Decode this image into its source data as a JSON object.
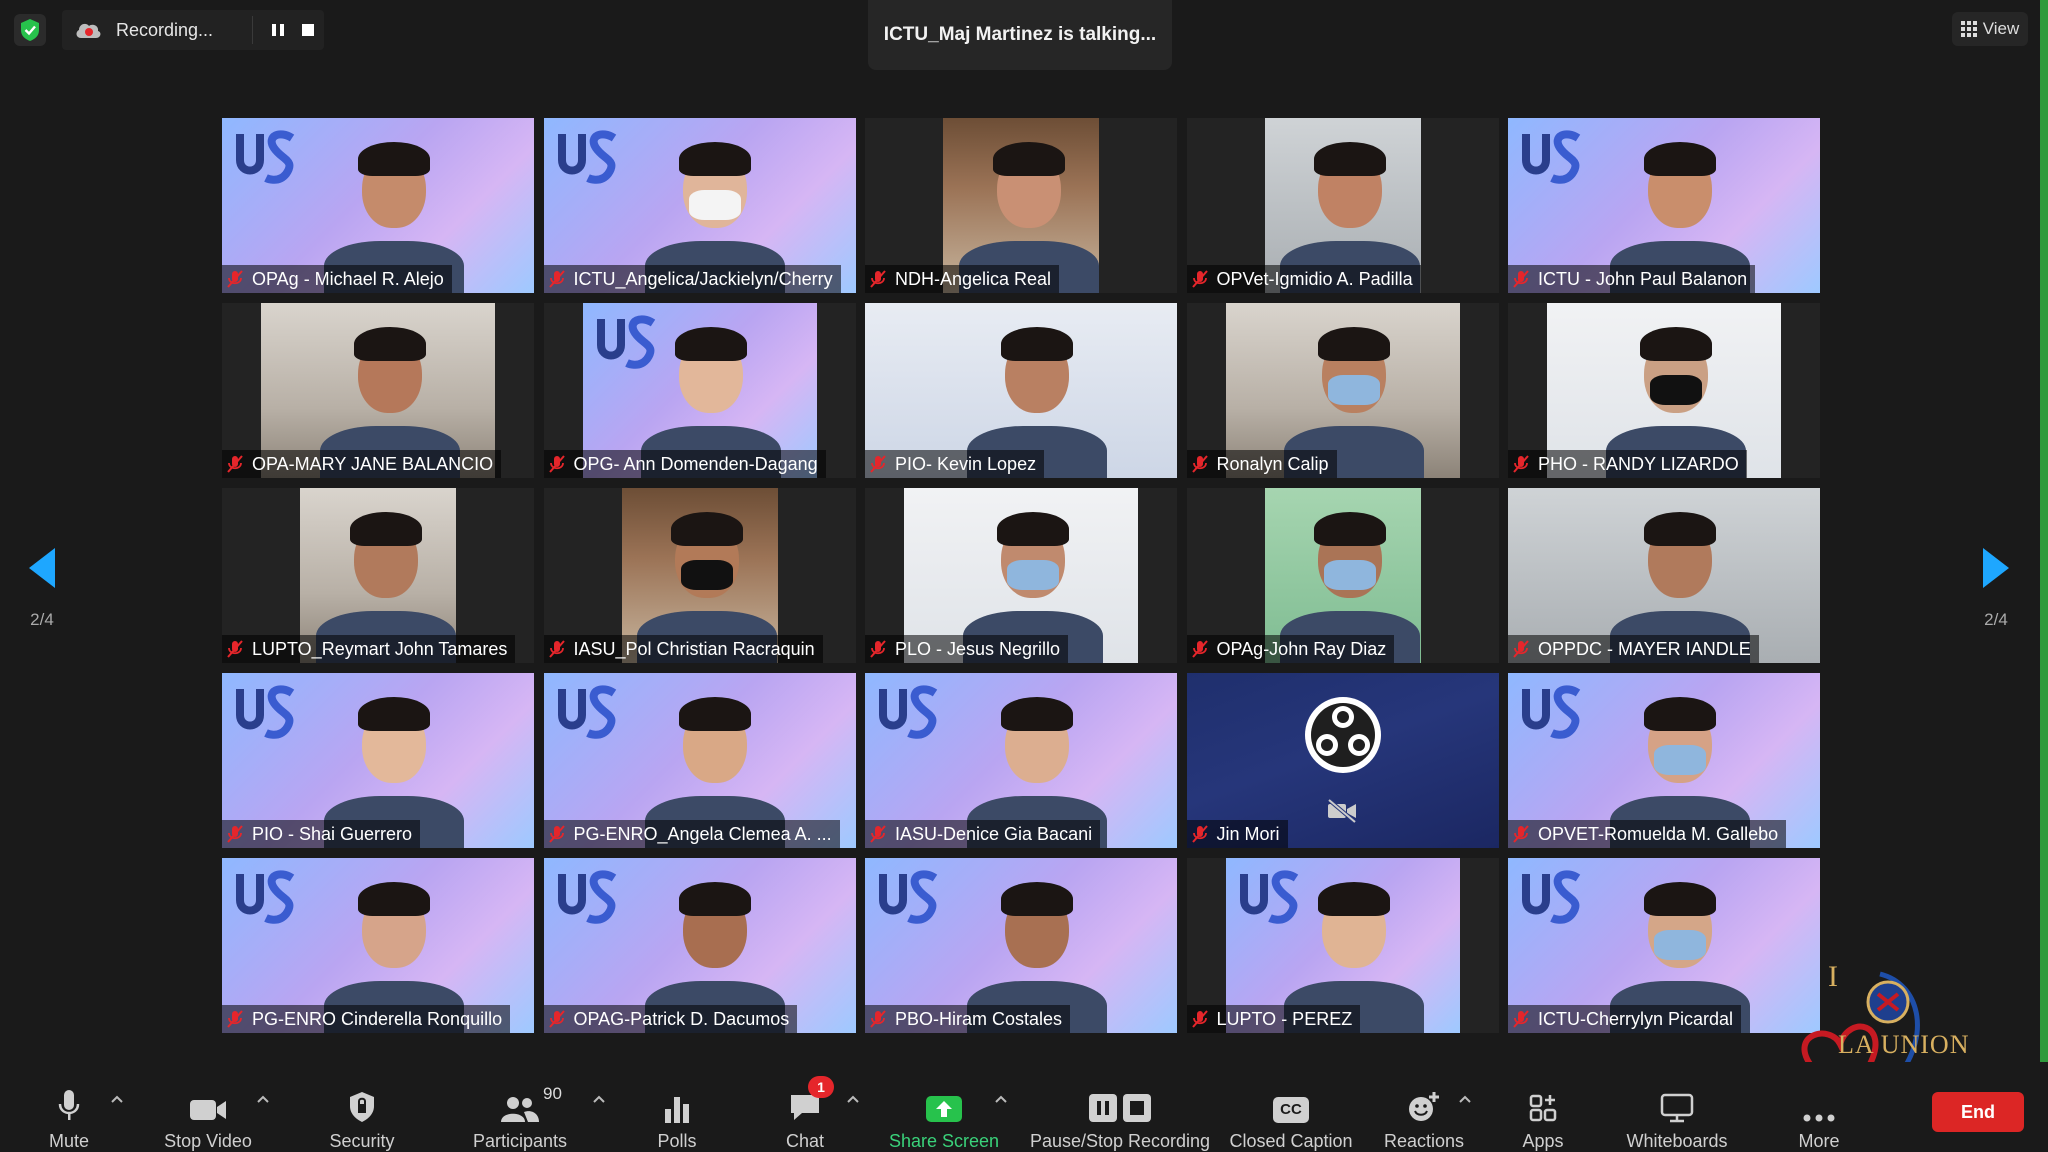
{
  "topbar": {
    "recording_label": "Recording...",
    "talking_label": "ICTU_Maj Martinez is talking...",
    "view_label": "View"
  },
  "pager": {
    "left_page": "2/4",
    "right_page": "2/4"
  },
  "colors": {
    "accent": "#1ea7ff",
    "share_green": "#3ad27a",
    "end_red": "#dc2625",
    "badge_red": "#e5262b"
  },
  "tiles": [
    {
      "name": "OPAg - Michael R. Alejo",
      "bg": "ws"
    },
    {
      "name": "ICTU_Angelica/Jackielyn/Cherry",
      "bg": "ws"
    },
    {
      "name": "NDH-Angelica Real",
      "bg": "wood"
    },
    {
      "name": "OPVet-Igmidio A. Padilla",
      "bg": "room"
    },
    {
      "name": "ICTU - John Paul Balanon",
      "bg": "ws"
    },
    {
      "name": "OPA-MARY JANE BALANCIO",
      "bg": "office"
    },
    {
      "name": "OPG- Ann Domenden-Dagang",
      "bg": "ws"
    },
    {
      "name": "PIO- Kevin Lopez",
      "bg": "pio"
    },
    {
      "name": "Ronalyn Calip",
      "bg": "office"
    },
    {
      "name": "PHO - RANDY LIZARDO",
      "bg": "white"
    },
    {
      "name": "LUPTO_Reymart John Tamares",
      "bg": "office"
    },
    {
      "name": "IASU_Pol Christian Racraquin",
      "bg": "wood"
    },
    {
      "name": "PLO - Jesus Negrillo",
      "bg": "white"
    },
    {
      "name": "OPAg-John Ray Diaz",
      "bg": "green"
    },
    {
      "name": "OPPDC - MAYER IANDLE",
      "bg": "room"
    },
    {
      "name": "PIO - Shai Guerrero",
      "bg": "ws"
    },
    {
      "name": "PG-ENRO_Angela Clemea A. ...",
      "bg": "ws"
    },
    {
      "name": "IASU-Denice Gia Bacani",
      "bg": "ws"
    },
    {
      "name": "Jin Mori",
      "bg": "obs"
    },
    {
      "name": "OPVET-Romuelda M. Gallebo",
      "bg": "ws"
    },
    {
      "name": "PG-ENRO Cinderella Ronquillo",
      "bg": "ws"
    },
    {
      "name": "OPAG-Patrick D. Dacumos",
      "bg": "ws"
    },
    {
      "name": "PBO-Hiram Costales",
      "bg": "ws"
    },
    {
      "name": "LUPTO - PEREZ",
      "bg": "ws"
    },
    {
      "name": "ICTU-Cherrylyn Picardal",
      "bg": "ws"
    }
  ],
  "toolbar": {
    "mute": "Mute",
    "stop_video": "Stop Video",
    "security": "Security",
    "participants": "Participants",
    "participants_count": "90",
    "polls": "Polls",
    "chat": "Chat",
    "chat_badge": "1",
    "share_screen": "Share Screen",
    "pause_stop_recording": "Pause/Stop Recording",
    "closed_caption": "Closed Caption",
    "closed_caption_glyph": "CC",
    "reactions": "Reactions",
    "apps": "Apps",
    "whiteboards": "Whiteboards",
    "more": "More",
    "end": "End"
  },
  "watermark": {
    "letter": "I",
    "text": "LA UNION"
  }
}
